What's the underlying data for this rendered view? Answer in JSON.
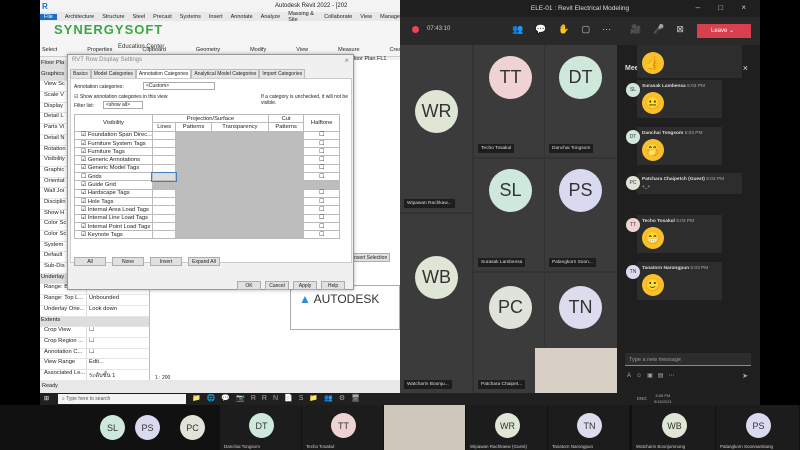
{
  "revit": {
    "title": "Autodesk Revit 2022 - [202",
    "tabs": [
      "File",
      "Architecture",
      "Structure",
      "Steel",
      "Precast",
      "Systems",
      "Insert",
      "Annotate",
      "Analyze",
      "Massing & Site",
      "Collaborate",
      "View",
      "Manage"
    ],
    "groups": [
      "Select",
      "Properties",
      "Clipboard",
      "Geometry",
      "Modify",
      "View",
      "Measure",
      "Create"
    ],
    "logo": "SYNERGYSOFT",
    "logo_sub": "Education Center",
    "view_tab": "wer Floor Plan FL1",
    "properties": [
      "Floor Pla",
      "Graphics",
      "View Sc",
      "Scale V",
      "Display",
      "Detail L",
      "Parts Vi",
      "Detail N",
      "Rotation",
      "Visibility",
      "Graphic",
      "Orientat",
      "Wall Joi",
      "Disciplin",
      "Show H",
      "Color Sc",
      "Color Sc",
      "System",
      "Default",
      "Sub-Dis"
    ],
    "underlay": "Underlay",
    "props2": [
      {
        "k": "Range: Base L...",
        "v": "None"
      },
      {
        "k": "Range: Top L...",
        "v": "Unbounded"
      },
      {
        "k": "Underlay Orie...",
        "v": "Look down"
      }
    ],
    "extents": "Extents",
    "props3": [
      {
        "k": "Crop View",
        "v": "☐"
      },
      {
        "k": "Crop Region ...",
        "v": "☐"
      },
      {
        "k": "Annotation C...",
        "v": "☐"
      },
      {
        "k": "View Range",
        "v": "Edit..."
      },
      {
        "k": "Associated Le...",
        "v": "ระดับชั้น 1"
      }
    ],
    "props_help": "Properties help",
    "apply": "Apply",
    "scale": "1 : 200",
    "status": "Ready",
    "insert_selection": "Insert Selection",
    "autodesk": "AUTODESK"
  },
  "dialog": {
    "title": "RVT Row Display Settings",
    "tabs": [
      "Basics",
      "Model Categories",
      "Annotation Categories",
      "Analytical Model Categories",
      "Import Categories"
    ],
    "ann_label": "Annotation categories:",
    "ann_value": "<Custom>",
    "show_label": "Show annotation categories in this view",
    "note": "If a category is unchecked, it will not be visible.",
    "filter_label": "Filter list:",
    "filter_value": "<show all>",
    "headers": {
      "visibility": "Visibility",
      "proj": "Projection/Surface",
      "cut": "Cut",
      "halftone": "Halftone",
      "lines": "Lines",
      "patterns": "Patterns",
      "transparency": "Transparency",
      "cut_patterns": "Patterns"
    },
    "rows": [
      {
        "name": "Foundation Span Direc...",
        "checked": true
      },
      {
        "name": "Furniture System Tags",
        "checked": true
      },
      {
        "name": "Furniture Tags",
        "checked": true
      },
      {
        "name": "Generic Annotations",
        "checked": true
      },
      {
        "name": "Generic Model Tags",
        "checked": true
      },
      {
        "name": "Grids",
        "checked": false
      },
      {
        "name": "Guide Grid",
        "checked": true
      },
      {
        "name": "Hardscape Tags",
        "checked": true
      },
      {
        "name": "Hole Tags",
        "checked": true
      },
      {
        "name": "Internal Area Load Tags",
        "checked": true
      },
      {
        "name": "Internal Line Load Tags",
        "checked": true
      },
      {
        "name": "Internal Point Load Tags",
        "checked": true
      },
      {
        "name": "Keynote Tags",
        "checked": true
      }
    ],
    "buttons": [
      "All",
      "None",
      "Invert",
      "Expand All"
    ],
    "footer": [
      "OK",
      "Cancel",
      "Apply",
      "Help"
    ]
  },
  "teams": {
    "title": "ELE-01 : Revit Electrical Modeling",
    "timer": "07:43:10",
    "leave": "Leave",
    "tiles": [
      {
        "i": "WR",
        "name": "Wipawan Rachkaw...",
        "color": "#dfe6d6"
      },
      {
        "i": "TT",
        "name": "Techo Tosakul",
        "color": "#efd3d3"
      },
      {
        "i": "DT",
        "name": "Danchai Tongsom",
        "color": "#cfe8dc"
      },
      {
        "i": "SL",
        "name": "Surasak Lambensa",
        "color": "#cfe8dc"
      },
      {
        "i": "PS",
        "name": "Palangkorn Soon...",
        "color": "#d9d9ef"
      },
      {
        "i": "WB",
        "name": "Watcharin Boonju...",
        "color": "#dfe6d6"
      },
      {
        "i": "PC",
        "name": "Patchara Chaipet...",
        "color": "#dfe3d9"
      },
      {
        "i": "TN",
        "name": "",
        "color": "#dcdcee"
      }
    ],
    "chat_title": "Meeting chat",
    "messages": [
      {
        "i": "",
        "name": "",
        "time": "",
        "emoji": "👍"
      },
      {
        "i": "SL",
        "name": "Surasak Lambensa",
        "time": "5:03 PM",
        "emoji": "😐",
        "color": "#cfe8dc"
      },
      {
        "i": "DT",
        "name": "Danchai Tongsom",
        "time": "5:03 PM",
        "emoji": "🤭",
        "color": "#cfe8dc"
      },
      {
        "i": "PC",
        "name": "Patchara Chaipetch (Guest)",
        "time": "5:03 PM",
        "text": "+_+",
        "color": "#dfe3d9"
      },
      {
        "i": "TT",
        "name": "Techo Tosakul",
        "time": "5:03 PM",
        "emoji": "😁",
        "color": "#efd3d3"
      },
      {
        "i": "TN",
        "name": "Tanatorn Narongpun",
        "time": "5:03 PM",
        "emoji": "🙂",
        "color": "#dcdcee"
      }
    ],
    "placeholder": "Type a new message"
  },
  "taskbar": {
    "search": "Type here to search",
    "lang": "ENG",
    "time": "5:08 PM",
    "date": "5/18/2021"
  },
  "bottom": [
    {
      "i": "SL",
      "name": "",
      "color": "#cfe8dc"
    },
    {
      "i": "PS",
      "name": "",
      "color": "#d9d9ef"
    },
    {
      "i": "PC",
      "name": "",
      "color": "#dfe3d9"
    },
    {
      "i": "DT",
      "name": "Danchai Tongsom",
      "color": "#cfe8dc"
    },
    {
      "i": "TT",
      "name": "Techo Tosakul",
      "color": "#efd3d3"
    },
    {
      "i": "WR",
      "name": "Wipawan Rachkaew (Guest)",
      "color": "#dfe6d6"
    },
    {
      "i": "TN",
      "name": "Tanatorn Narongpun",
      "color": "#dcdcee"
    },
    {
      "i": "WB",
      "name": "Watcharin Boonjumnong",
      "color": "#dfe6d6"
    },
    {
      "i": "PS",
      "name": "Palangkorn Soonnamtiang",
      "color": "#d9d9ef"
    }
  ]
}
